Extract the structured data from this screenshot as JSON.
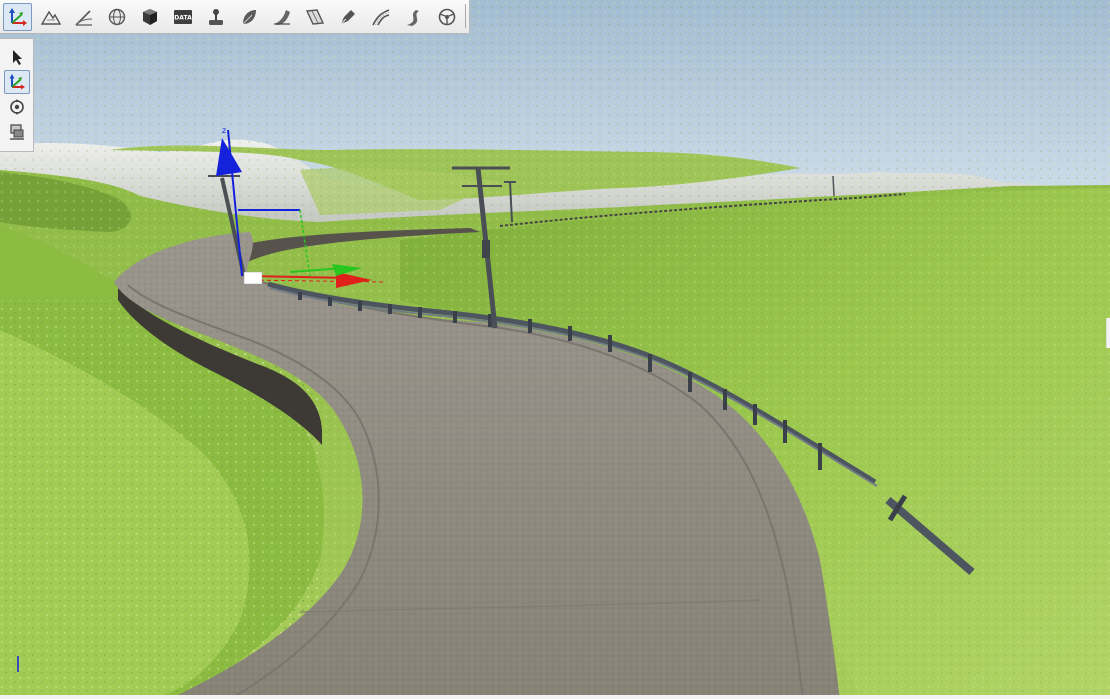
{
  "app": {
    "mode": "3d-scene-editor"
  },
  "toolbar": {
    "items": [
      {
        "icon": "move-gizmo-icon",
        "active": true
      },
      {
        "icon": "terrain-icon",
        "active": false
      },
      {
        "icon": "road-edit-icon",
        "active": false
      },
      {
        "icon": "globe-icon",
        "active": false
      },
      {
        "icon": "cube-icon",
        "active": false
      },
      {
        "icon": "data-icon",
        "label": "DATA",
        "active": false
      },
      {
        "icon": "joystick-icon",
        "active": false
      },
      {
        "icon": "leaf-icon",
        "active": false
      },
      {
        "icon": "ramp-icon",
        "active": false
      },
      {
        "icon": "bridge-icon",
        "active": false
      },
      {
        "icon": "pen-icon",
        "active": false
      },
      {
        "icon": "curve-road-icon",
        "active": false
      },
      {
        "icon": "s-curve-icon",
        "active": false
      },
      {
        "icon": "steering-wheel-icon",
        "active": false
      }
    ]
  },
  "side_toolbar": {
    "items": [
      {
        "icon": "pointer-icon",
        "active": false
      },
      {
        "icon": "move-gizmo-icon",
        "active": true
      },
      {
        "icon": "rotate-gizmo-icon",
        "active": false
      },
      {
        "icon": "scale-gizmo-icon",
        "active": false
      }
    ]
  },
  "scene": {
    "sky_top": "#a3bcd2",
    "sky_bottom": "#d6e3ee",
    "grass": "#9cc649",
    "road": "#8c8679",
    "gizmo_axes": {
      "x": "#e0201b",
      "y": "#29c61f",
      "z": "#1522dc"
    }
  }
}
